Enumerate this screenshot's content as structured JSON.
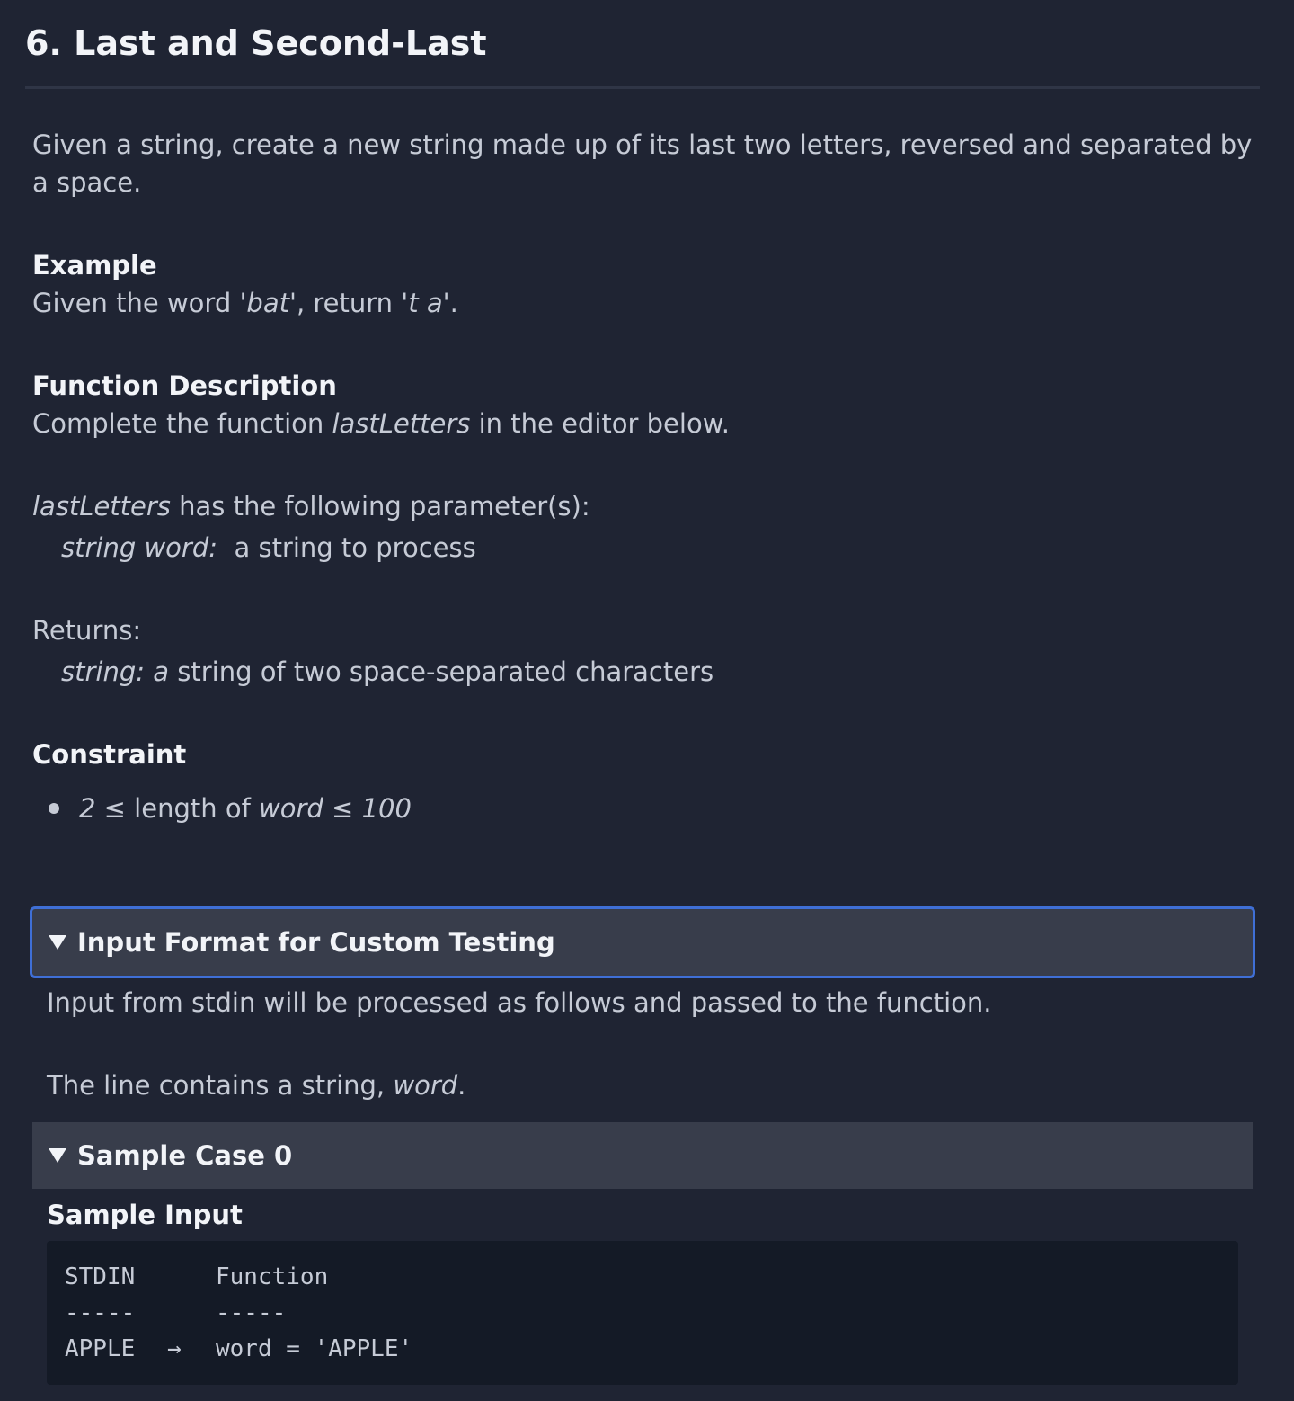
{
  "title": "6. Last and Second-Last",
  "description": {
    "intro": "Given a string, create a new string made up of its last two letters, reversed and separated by a space.",
    "example_heading": "Example",
    "example_pre": "Given the word '",
    "example_word": "bat",
    "example_mid": "', return '",
    "example_result": "t a",
    "example_post": "'.",
    "function_heading": "Function Description",
    "function_pre": "Complete the function ",
    "function_name": "lastLetters",
    "function_post": " in the editor below.",
    "params_fn_name": "lastLetters",
    "params_post": " has the following parameter(s):",
    "param_name": "string word:",
    "param_desc": "  a string to process",
    "returns_label": "Returns:",
    "returns_type": "string: a",
    "returns_desc": " string of two space-separated characters",
    "constraint_heading": "Constraint",
    "constraint_pre": "2 ≤",
    "constraint_mid": " length of ",
    "constraint_word": "word",
    "constraint_post": " ≤ 100"
  },
  "input_format": {
    "summary": "Input Format for Custom Testing",
    "line1": "Input from stdin will be processed as follows and passed to the function.",
    "line2_pre": "The line contains a string, ",
    "line2_word": "word",
    "line2_post": "."
  },
  "sample_case": {
    "summary": "Sample Case 0",
    "input_label": "Sample Input",
    "rows": [
      {
        "stdin": "STDIN",
        "arrow": "",
        "fn": "Function"
      },
      {
        "stdin": "-----",
        "arrow": "",
        "fn": "-----"
      },
      {
        "stdin": "APPLE",
        "arrow": "→",
        "fn": "word = 'APPLE'"
      }
    ]
  }
}
